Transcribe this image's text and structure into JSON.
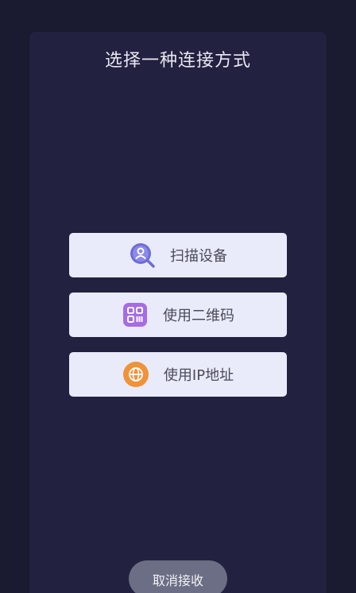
{
  "dialog": {
    "title": "选择一种连接方式"
  },
  "options": [
    {
      "label": "扫描设备",
      "icon": "scan-device-icon"
    },
    {
      "label": "使用二维码",
      "icon": "qr-code-icon"
    },
    {
      "label": "使用IP地址",
      "icon": "globe-icon"
    }
  ],
  "footer": {
    "cancel_label": "取消接收"
  },
  "colors": {
    "background": "#1a1a30",
    "panel": "#222140",
    "option_bg": "#e9ebfb",
    "scan_icon": "#6f6bd8",
    "qr_icon": "#a66be6",
    "globe_icon": "#f0923a",
    "cancel_bg": "#6b6e84"
  }
}
